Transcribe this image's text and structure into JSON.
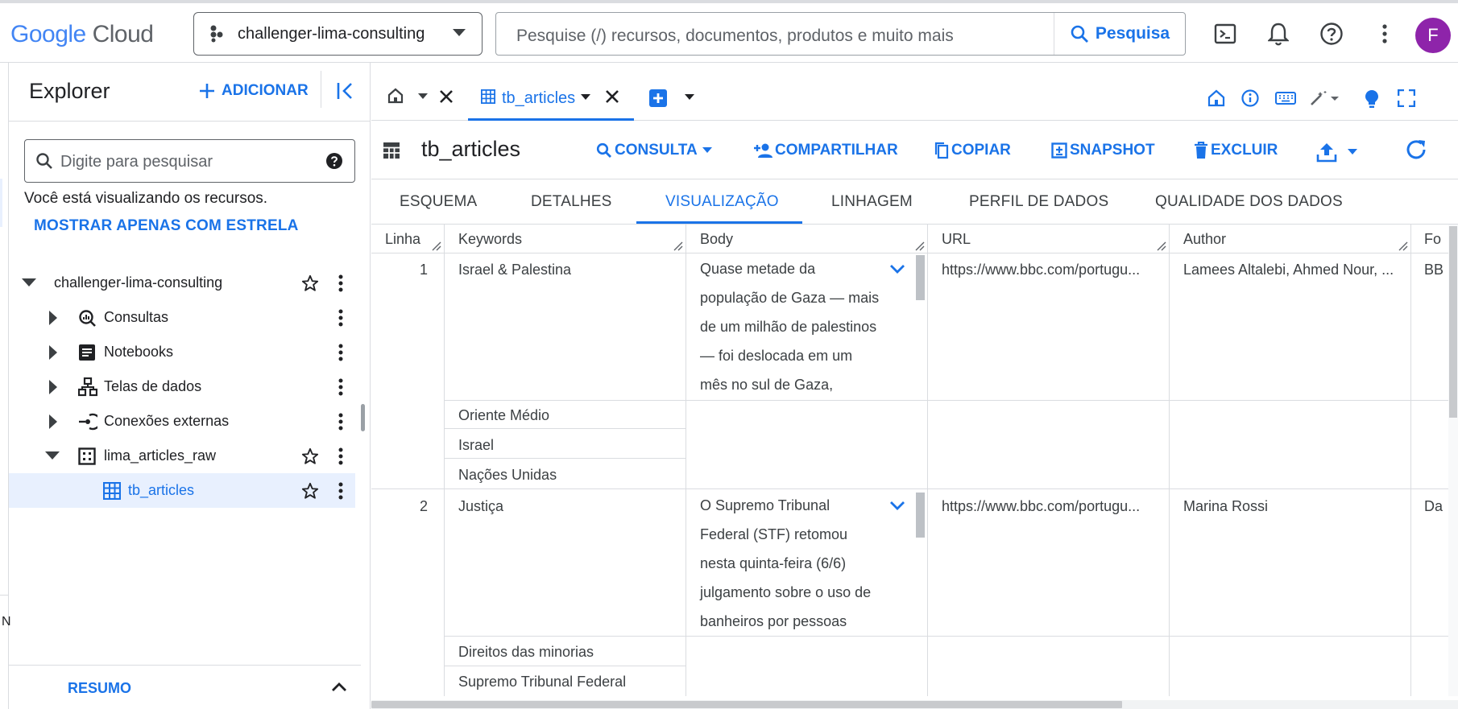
{
  "topbar": {
    "logo_google": "Google",
    "logo_cloud": "Cloud",
    "project": "challenger-lima-consulting",
    "search_placeholder": "Pesquise (/) recursos, documentos, produtos e muito mais",
    "search_button": "Pesquisa",
    "avatar_initial": "F",
    "icons": [
      "terminal-icon",
      "bell-icon",
      "help-icon",
      "more-vert-icon"
    ]
  },
  "explorer": {
    "title": "Explorer",
    "add_label": "ADICIONAR",
    "search_placeholder": "Digite para pesquisar",
    "info_text": "Você está visualizando os recursos.",
    "starred_link": "MOSTRAR APENAS COM ESTRELA",
    "tree": {
      "project": "challenger-lima-consulting",
      "items": [
        {
          "label": "Consultas",
          "icon": "query-icon"
        },
        {
          "label": "Notebooks",
          "icon": "notebook-icon"
        },
        {
          "label": "Telas de dados",
          "icon": "data-canvas-icon"
        },
        {
          "label": "Conexões externas",
          "icon": "external-connection-icon"
        },
        {
          "label": "lima_articles_raw",
          "icon": "dataset-icon"
        },
        {
          "label": "tb_articles",
          "icon": "table-icon"
        }
      ]
    },
    "summary_label": "RESUMO",
    "edge_char": "N"
  },
  "tabs": {
    "active_tab": "tb_articles"
  },
  "table_header": {
    "title": "tb_articles",
    "actions": {
      "query": "CONSULTA",
      "share": "COMPARTILHAR",
      "copy": "COPIAR",
      "snapshot": "SNAPSHOT",
      "delete": "EXCLUIR"
    }
  },
  "subtabs": [
    "ESQUEMA",
    "DETALHES",
    "VISUALIZAÇÃO",
    "LINHAGEM",
    "PERFIL DE DADOS",
    "QUALIDADE DOS DADOS"
  ],
  "grid": {
    "columns": [
      "Linha",
      "Keywords",
      "Body",
      "URL",
      "Author",
      "Fo"
    ],
    "rows": [
      {
        "line": "1",
        "keywords": [
          "Israel & Palestina",
          "Oriente Médio",
          "Israel",
          "Nações Unidas"
        ],
        "body": [
          "Quase metade da",
          "população de Gaza — mais",
          "de um milhão de palestinos",
          "— foi deslocada em um",
          "mês no sul de Gaza,"
        ],
        "url": "https://www.bbc.com/portugu...",
        "author": "Lamees Altalebi, Ahmed Nour, ...",
        "fo": "BB"
      },
      {
        "line": "2",
        "keywords": [
          "Justiça",
          "Direitos das minorias",
          "Supremo Tribunal Federal"
        ],
        "body": [
          "O Supremo Tribunal",
          "Federal (STF) retomou",
          "nesta quinta-feira (6/6)",
          "julgamento sobre o uso de",
          "banheiros por pessoas"
        ],
        "url": "https://www.bbc.com/portugu...",
        "author": "Marina Rossi",
        "fo": "Da"
      }
    ]
  },
  "colors": {
    "accent": "#1a73e8",
    "avatar": "#8e24aa",
    "divider": "#dadce0",
    "selected_row": "#e8f0fe"
  }
}
